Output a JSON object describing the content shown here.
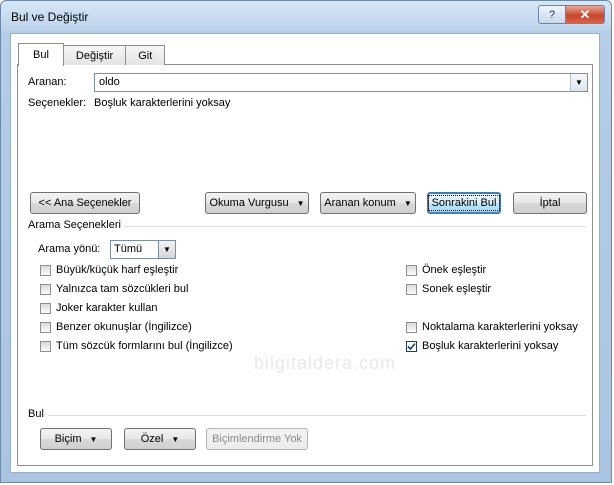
{
  "window": {
    "title": "Bul ve Değiştir",
    "close_label": "✕",
    "help_label": "?"
  },
  "tabs": [
    {
      "label": "Bul",
      "active": true
    },
    {
      "label": "Değiştir",
      "active": false
    },
    {
      "label": "Git",
      "active": false
    }
  ],
  "find": {
    "label": "Aranan:",
    "value": "oldo"
  },
  "options_summary": {
    "label": "Seçenekler:",
    "value": "Boşluk karakterlerini yoksay"
  },
  "buttons": {
    "less": "<< Ana Seçenekler",
    "reading_highlight": "Okuma Vurgusu",
    "find_in": "Aranan konum",
    "find_next": "Sonrakini Bul",
    "cancel": "İptal"
  },
  "search_options": {
    "section_label": "Arama Seçenekleri",
    "direction_label": "Arama yönü:",
    "direction_value": "Tümü",
    "left_checks": [
      {
        "label": "Büyük/küçük harf eşleştir",
        "checked": false
      },
      {
        "label": "Yalnızca tam sözcükleri bul",
        "checked": false
      },
      {
        "label": "Joker karakter kullan",
        "checked": false
      },
      {
        "label": "Benzer okunuşlar (İngilizce)",
        "checked": false
      },
      {
        "label": "Tüm sözcük formlarını bul (İngilizce)",
        "checked": false
      }
    ],
    "right_checks": [
      {
        "label": "Önek eşleştir",
        "checked": false
      },
      {
        "label": "Sonek eşleştir",
        "checked": false
      },
      {
        "label": "Noktalama karakterlerini yoksay",
        "checked": false
      },
      {
        "label": "Boşluk karakterlerini yoksay",
        "checked": true
      }
    ]
  },
  "find_section": {
    "label": "Bul",
    "format": "Biçim",
    "special": "Özel",
    "no_formatting": "Biçimlendirme Yok"
  },
  "watermark": "bilgitaldera.com"
}
